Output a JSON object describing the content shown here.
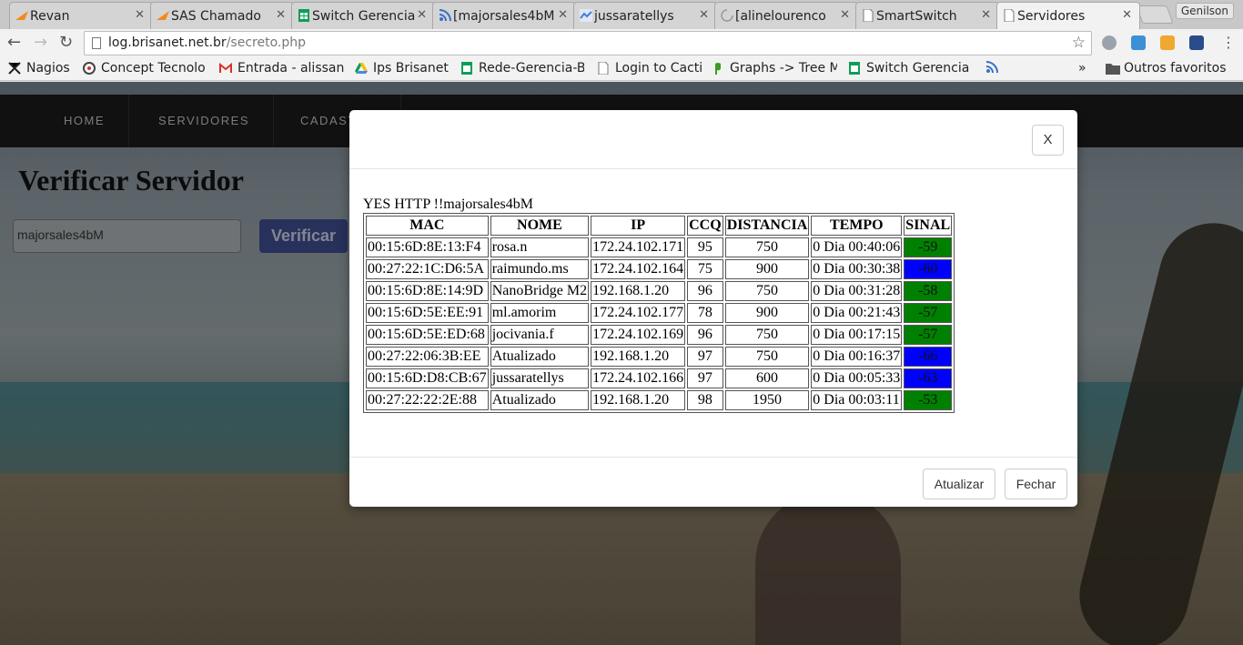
{
  "browser": {
    "tabs": [
      {
        "title": "Revan",
        "icon": "sas-icon",
        "color": "#f28a1e"
      },
      {
        "title": "SAS Chamado",
        "icon": "sas-icon",
        "color": "#f28a1e"
      },
      {
        "title": "Switch Gerencia",
        "icon": "sheets-icon",
        "color": "#0f9d58"
      },
      {
        "title": "[majorsales4bM",
        "icon": "rss-icon",
        "color": "#3b6fc7"
      },
      {
        "title": "jussaratellys",
        "icon": "mikrotik-icon",
        "color": "#4a7bd0"
      },
      {
        "title": "[alinelourenco",
        "icon": "loading-icon",
        "color": "#999999"
      },
      {
        "title": "SmartSwitch",
        "icon": "page-icon",
        "color": "#777777"
      },
      {
        "title": "Servidores",
        "icon": "page-icon",
        "color": "#777777"
      }
    ],
    "profile_name": "Genilson",
    "url_host": "log.brisanet.net.br",
    "url_path": "/secreto.php",
    "bookmarks": [
      {
        "label": "Nagios",
        "icon": "nagios-icon"
      },
      {
        "label": "Concept Tecnolo",
        "icon": "concept-icon"
      },
      {
        "label": "Entrada - alissan",
        "icon": "gmail-icon"
      },
      {
        "label": "Ips Brisanet",
        "icon": "drive-icon"
      },
      {
        "label": "Rede-Gerencia-Br",
        "icon": "sheets-icon"
      },
      {
        "label": "Login to Cacti",
        "icon": "page-icon"
      },
      {
        "label": "Graphs -> Tree M",
        "icon": "cacti-icon"
      },
      {
        "label": "Switch Gerencia",
        "icon": "sheets-icon"
      }
    ],
    "bookmarks_more": "»",
    "other_bookmarks": "Outros favoritos"
  },
  "site": {
    "nav": [
      "HOME",
      "SERVIDORES",
      "CADASTRO"
    ],
    "page_title": "Verificar Servidor",
    "server_input_value": "majorsales4bM",
    "verify_label": "Verificar"
  },
  "modal": {
    "close_label": "X",
    "status_text": "YES HTTP !!majorsales4bM",
    "table": {
      "headers": [
        "MAC",
        "NOME",
        "IP",
        "CCQ",
        "DISTANCIA",
        "TEMPO",
        "SINAL"
      ],
      "rows": [
        {
          "mac": "00:15:6D:8E:13:F4",
          "nome": "rosa.n",
          "ip": "172.24.102.171",
          "ccq": "95",
          "distancia": "750",
          "tempo": "0 Dia 00:40:06",
          "sinal": "-59",
          "sinal_color": "#008000"
        },
        {
          "mac": "00:27:22:1C:D6:5A",
          "nome": "raimundo.ms",
          "ip": "172.24.102.164",
          "ccq": "75",
          "distancia": "900",
          "tempo": "0 Dia 00:30:38",
          "sinal": "-60",
          "sinal_color": "#0000ff"
        },
        {
          "mac": "00:15:6D:8E:14:9D",
          "nome": "NanoBridge M2",
          "ip": "192.168.1.20",
          "ccq": "96",
          "distancia": "750",
          "tempo": "0 Dia 00:31:28",
          "sinal": "-58",
          "sinal_color": "#008000"
        },
        {
          "mac": "00:15:6D:5E:EE:91",
          "nome": "ml.amorim",
          "ip": "172.24.102.177",
          "ccq": "78",
          "distancia": "900",
          "tempo": "0 Dia 00:21:43",
          "sinal": "-57",
          "sinal_color": "#008000"
        },
        {
          "mac": "00:15:6D:5E:ED:68",
          "nome": "jocivania.f",
          "ip": "172.24.102.169",
          "ccq": "96",
          "distancia": "750",
          "tempo": "0 Dia 00:17:15",
          "sinal": "-57",
          "sinal_color": "#008000"
        },
        {
          "mac": "00:27:22:06:3B:EE",
          "nome": "Atualizado",
          "ip": "192.168.1.20",
          "ccq": "97",
          "distancia": "750",
          "tempo": "0 Dia 00:16:37",
          "sinal": "-66",
          "sinal_color": "#0000ff"
        },
        {
          "mac": "00:15:6D:D8:CB:67",
          "nome": "jussaratellys",
          "ip": "172.24.102.166",
          "ccq": "97",
          "distancia": "600",
          "tempo": "0 Dia 00:05:33",
          "sinal": "-63",
          "sinal_color": "#0000ff"
        },
        {
          "mac": "00:27:22:22:2E:88",
          "nome": "Atualizado",
          "ip": "192.168.1.20",
          "ccq": "98",
          "distancia": "1950",
          "tempo": "0 Dia 00:03:11",
          "sinal": "-53",
          "sinal_color": "#008000"
        }
      ]
    },
    "update_label": "Atualizar",
    "close_footer_label": "Fechar"
  }
}
